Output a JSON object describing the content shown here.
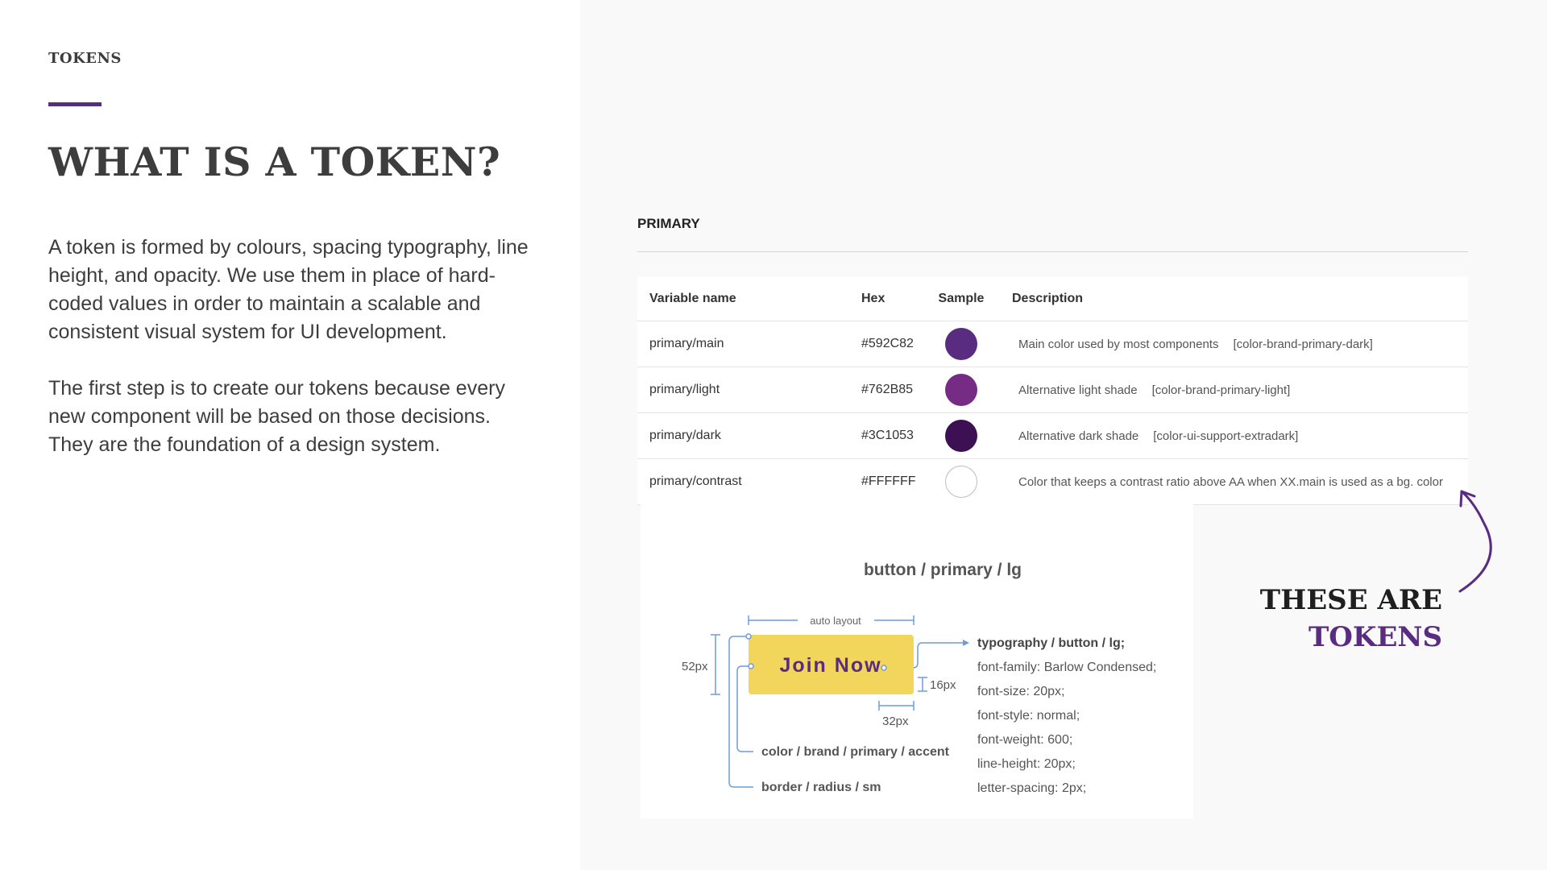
{
  "eyebrow": "TOKENS",
  "headline": "WHAT IS A TOKEN?",
  "intro": {
    "p1": "A token is formed by colours, spacing typography, line height, and opacity. We use them in place of hard-coded values in order to maintain a scalable and consistent visual system for UI development.",
    "p2": "The first step is to create our tokens because every new component will be based on those decisions. They are the foundation of a design system."
  },
  "primary_section": {
    "title": "PRIMARY",
    "columns": [
      "Variable name",
      "Hex",
      "Sample",
      "Description"
    ],
    "rows": [
      {
        "name": "primary/main",
        "hex": "#592C82",
        "color": "#592c82",
        "desc": "Main color used by most components",
        "ref": "[color-brand-primary-dark]"
      },
      {
        "name": "primary/light",
        "hex": "#762B85",
        "color": "#762b85",
        "desc": "Alternative light shade",
        "ref": "[color-brand-primary-light]"
      },
      {
        "name": "primary/dark",
        "hex": "#3C1053",
        "color": "#3c1053",
        "desc": "Alternative dark shade",
        "ref": "[color-ui-support-extradark]"
      },
      {
        "name": "primary/contrast",
        "hex": "#FFFFFF",
        "color": "#ffffff",
        "desc": "Color that keeps a contrast ratio above AA when XX.main is used as a bg. color",
        "ref": ""
      }
    ]
  },
  "button_illustration": {
    "title": "button / primary / lg",
    "button_label": "Join Now",
    "button_color": "#f2d65c",
    "button_text_color": "#592c82",
    "guide_color": "#6d9ce0",
    "auto_layout": "auto layout",
    "height_label": "52px",
    "padding_v_label": "16px",
    "padding_h_label": "32px",
    "color_token": "color / brand / primary / accent",
    "border_token": "border / radius / sm",
    "typography_token": "typography / button / lg;",
    "typography_props": [
      "font-family: Barlow Condensed;",
      "font-size: 20px;",
      "font-style: normal;",
      "font-weight: 600;",
      "line-height: 20px;",
      "letter-spacing: 2px;"
    ]
  },
  "callout": {
    "line1": "THESE ARE",
    "line2": "TOKENS"
  },
  "colors": {
    "brand_purple": "#592c82",
    "text_dark": "#3d3d3d",
    "panel_bg": "#f9f9f9"
  }
}
